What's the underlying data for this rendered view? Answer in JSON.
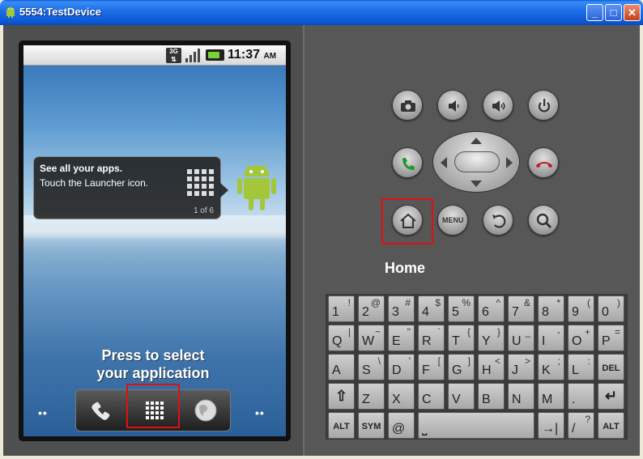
{
  "window": {
    "title": "5554:TestDevice"
  },
  "phone": {
    "status": {
      "network": "3G",
      "time": "11:37",
      "ampm": "AM"
    },
    "tip": {
      "title": "See all your apps.",
      "body": "Touch the Launcher icon.",
      "page": "1 of 6"
    },
    "press_line1": "Press to select",
    "press_line2": "your application",
    "dock": {
      "left_dots": "••",
      "right_dots": "••"
    }
  },
  "controls": {
    "menu_label": "MENU",
    "hover_label": "Home"
  },
  "keyboard": {
    "row1": [
      {
        "k": "1",
        "s": "!"
      },
      {
        "k": "2",
        "s": "@"
      },
      {
        "k": "3",
        "s": "#"
      },
      {
        "k": "4",
        "s": "$"
      },
      {
        "k": "5",
        "s": "%"
      },
      {
        "k": "6",
        "s": "^"
      },
      {
        "k": "7",
        "s": "&"
      },
      {
        "k": "8",
        "s": "*"
      },
      {
        "k": "9",
        "s": "("
      },
      {
        "k": "0",
        "s": ")"
      }
    ],
    "row2": [
      {
        "k": "Q",
        "s": "|"
      },
      {
        "k": "W",
        "s": "~"
      },
      {
        "k": "E",
        "s": "\""
      },
      {
        "k": "R",
        "s": "`"
      },
      {
        "k": "T",
        "s": "{"
      },
      {
        "k": "Y",
        "s": "}"
      },
      {
        "k": "U",
        "s": "_"
      },
      {
        "k": "I",
        "s": "-"
      },
      {
        "k": "O",
        "s": "+"
      },
      {
        "k": "P",
        "s": "="
      }
    ],
    "row3": [
      {
        "k": "A",
        "s": ""
      },
      {
        "k": "S",
        "s": "\\"
      },
      {
        "k": "D",
        "s": "'"
      },
      {
        "k": "F",
        "s": "["
      },
      {
        "k": "G",
        "s": "]"
      },
      {
        "k": "H",
        "s": "<"
      },
      {
        "k": "J",
        "s": ">"
      },
      {
        "k": "K",
        "s": ";"
      },
      {
        "k": "L",
        "s": ":"
      },
      {
        "k": "DEL",
        "s": ""
      }
    ],
    "row4": [
      {
        "k": "⇧",
        "s": ""
      },
      {
        "k": "Z",
        "s": ""
      },
      {
        "k": "X",
        "s": ""
      },
      {
        "k": "C",
        "s": ""
      },
      {
        "k": "V",
        "s": ""
      },
      {
        "k": "B",
        "s": ""
      },
      {
        "k": "N",
        "s": ""
      },
      {
        "k": "M",
        "s": ""
      },
      {
        "k": ".",
        "s": ""
      },
      {
        "k": "↵",
        "s": ""
      }
    ],
    "row5": {
      "alt_left": "ALT",
      "sym": "SYM",
      "at": "@",
      "space": "⎵",
      "tab": "→|",
      "slash": "/",
      "question": "?",
      "alt_right": "ALT"
    }
  }
}
